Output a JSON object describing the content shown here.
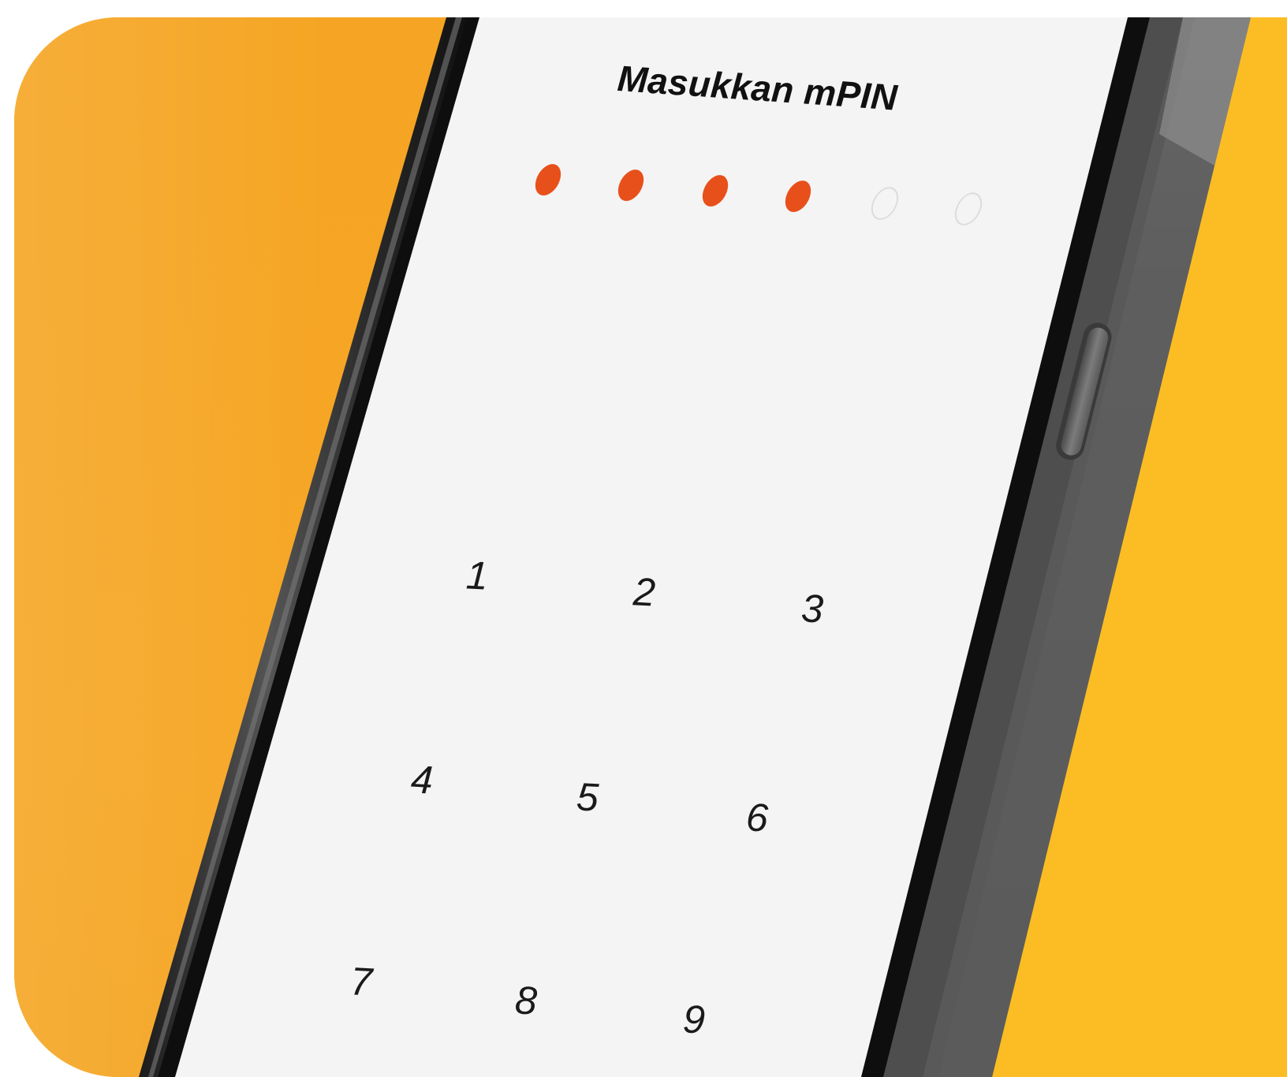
{
  "screen": {
    "title": "Masukkan mPIN"
  },
  "pin": {
    "length": 6,
    "entered": 4,
    "dots": [
      {
        "state": "filled"
      },
      {
        "state": "filled"
      },
      {
        "state": "filled"
      },
      {
        "state": "filled"
      },
      {
        "state": "empty"
      },
      {
        "state": "empty"
      }
    ]
  },
  "keypad": {
    "keys": [
      "1",
      "2",
      "3",
      "4",
      "5",
      "6",
      "7",
      "8",
      "9"
    ]
  },
  "colors": {
    "accent": "#e8501b",
    "background_left": "#f5a523",
    "background_right": "#fbbd23",
    "screen": "#f4f4f4",
    "device_frame": "#3a3a3a"
  }
}
